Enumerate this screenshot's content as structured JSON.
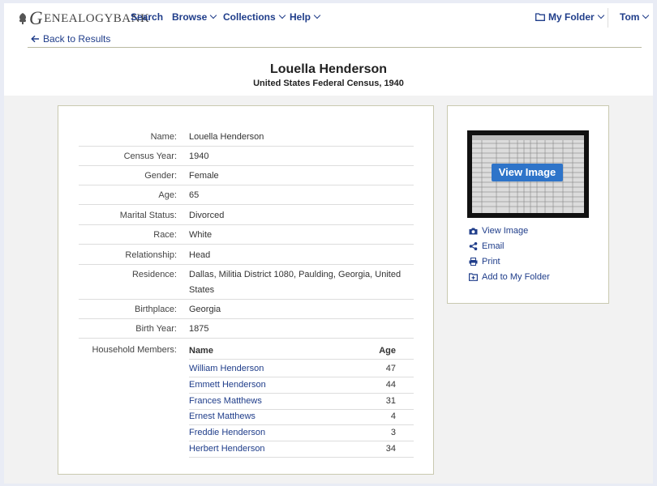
{
  "header": {
    "logo_initial": "G",
    "logo_rest": "ENEALOGYBANK",
    "nav": [
      {
        "label": "Search",
        "dropdown": false
      },
      {
        "label": "Browse",
        "dropdown": true
      },
      {
        "label": "Collections",
        "dropdown": true
      },
      {
        "label": "Help",
        "dropdown": true
      }
    ],
    "my_folder": "My Folder",
    "user": "Tom",
    "back_label": "Back to Results"
  },
  "record": {
    "title": "Louella Henderson",
    "subtitle": "United States Federal Census, 1940",
    "fields": [
      {
        "label": "Name:",
        "value": "Louella Henderson"
      },
      {
        "label": "Census Year:",
        "value": "1940"
      },
      {
        "label": "Gender:",
        "value": "Female"
      },
      {
        "label": "Age:",
        "value": "65"
      },
      {
        "label": "Marital Status:",
        "value": "Divorced"
      },
      {
        "label": "Race:",
        "value": "White"
      },
      {
        "label": "Relationship:",
        "value": "Head"
      },
      {
        "label": "Residence:",
        "value": "Dallas, Militia District 1080, Paulding, Georgia, United States"
      },
      {
        "label": "Birthplace:",
        "value": "Georgia"
      },
      {
        "label": "Birth Year:",
        "value": "1875"
      }
    ],
    "household_label": "Household Members:",
    "household_headers": {
      "name": "Name",
      "age": "Age"
    },
    "household": [
      {
        "name": "William Henderson",
        "age": "47"
      },
      {
        "name": "Emmett Henderson",
        "age": "44"
      },
      {
        "name": "Frances Matthews",
        "age": "31"
      },
      {
        "name": "Ernest Matthews",
        "age": "4"
      },
      {
        "name": "Freddie Henderson",
        "age": "3"
      },
      {
        "name": "Herbert Henderson",
        "age": "34"
      }
    ]
  },
  "sidebar": {
    "thumb_button": "View Image",
    "actions": [
      {
        "label": "View Image",
        "icon": "camera-icon"
      },
      {
        "label": "Email",
        "icon": "share-icon"
      },
      {
        "label": "Print",
        "icon": "printer-icon"
      },
      {
        "label": "Add to My Folder",
        "icon": "folder-plus-icon"
      }
    ]
  },
  "colors": {
    "link": "#1f3d8a",
    "accent": "#2e74c9",
    "border": "#c9c9b0"
  }
}
